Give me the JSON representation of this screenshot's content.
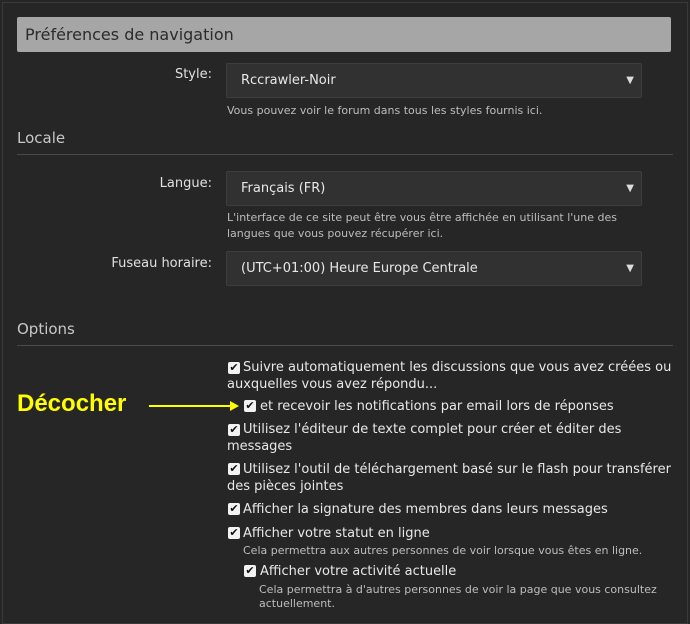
{
  "header": {
    "title": "Préférences de navigation"
  },
  "style": {
    "label": "Style:",
    "value": "Rccrawler-Noir",
    "help": "Vous pouvez voir le forum dans tous les styles fournis ici."
  },
  "locale": {
    "title": "Locale",
    "language": {
      "label": "Langue:",
      "value": "Français (FR)",
      "help": [
        "L'interface de ce site peut être vous être affichée en utilisant l'une des",
        "langues que vous pouvez récupérer ici."
      ]
    },
    "timezone": {
      "label": "Fuseau horaire:",
      "value": "(UTC+01:00) Heure Europe Centrale"
    }
  },
  "options": {
    "title": "Options",
    "items": [
      {
        "lines": [
          "Suivre automatiquement les discussions que vous avez créées ou",
          "auxquelles vous avez répondu..."
        ],
        "checked": true
      },
      {
        "lines": [
          "et recevoir les notifications par email lors de réponses"
        ],
        "checked": true
      },
      {
        "lines": [
          "Utilisez l'éditeur de texte complet pour créer et éditer des",
          "messages"
        ],
        "checked": true
      },
      {
        "lines": [
          "Utilisez l'outil de téléchargement basé sur le flash pour transférer",
          "des pièces jointes"
        ],
        "checked": true
      },
      {
        "lines": [
          "Afficher la signature des membres dans leurs messages"
        ],
        "checked": true
      },
      {
        "lines": [
          "Afficher votre statut en ligne"
        ],
        "checked": true,
        "help": [
          "Cela permettra aux autres personnes de voir lorsque vous êtes en ligne."
        ]
      },
      {
        "lines": [
          "Afficher votre activité actuelle"
        ],
        "checked": true,
        "help": [
          "Cela permettra à d'autres personnes de voir la page que vous consultez",
          "actuellement."
        ]
      }
    ]
  },
  "annotation": {
    "text": "Décocher",
    "color": "#ffff00"
  },
  "icons": {
    "checkbox": "✔",
    "dropdown": "▼"
  }
}
